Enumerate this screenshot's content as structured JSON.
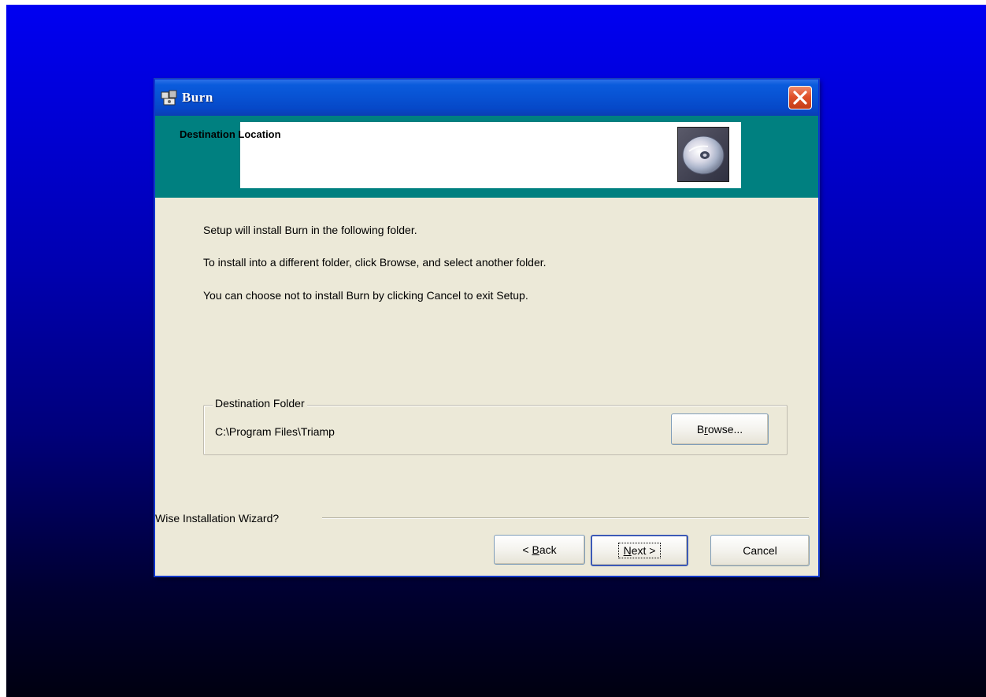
{
  "window": {
    "title": "Burn",
    "icon": "setup-app-icon",
    "close_icon": "close-icon"
  },
  "banner": {
    "title": "Destination Location",
    "image": "cd-disc-icon",
    "accent_color": "#008080"
  },
  "body": {
    "lines": [
      "Setup will install Burn in the following folder.",
      "To install into a different folder, click Browse, and select another folder.",
      "You can choose not to install Burn by clicking Cancel to exit Setup."
    ]
  },
  "destination": {
    "group_label": "Destination Folder",
    "path": "C:\\Program Files\\Triamp",
    "browse_label_pre": "B",
    "browse_label_accel": "r",
    "browse_label_post": "owse..."
  },
  "footer": {
    "wizard_label": "Wise Installation Wizard?",
    "back_label_pre": "< ",
    "back_label_accel": "B",
    "back_label_post": "ack",
    "next_label_accel": "N",
    "next_label_post": "ext >",
    "cancel_label": "Cancel"
  },
  "colors": {
    "desktop_top": "#0000f2",
    "desktop_bottom": "#000010",
    "dialog_face": "#ece9d8",
    "titlebar": "#0853d4"
  }
}
